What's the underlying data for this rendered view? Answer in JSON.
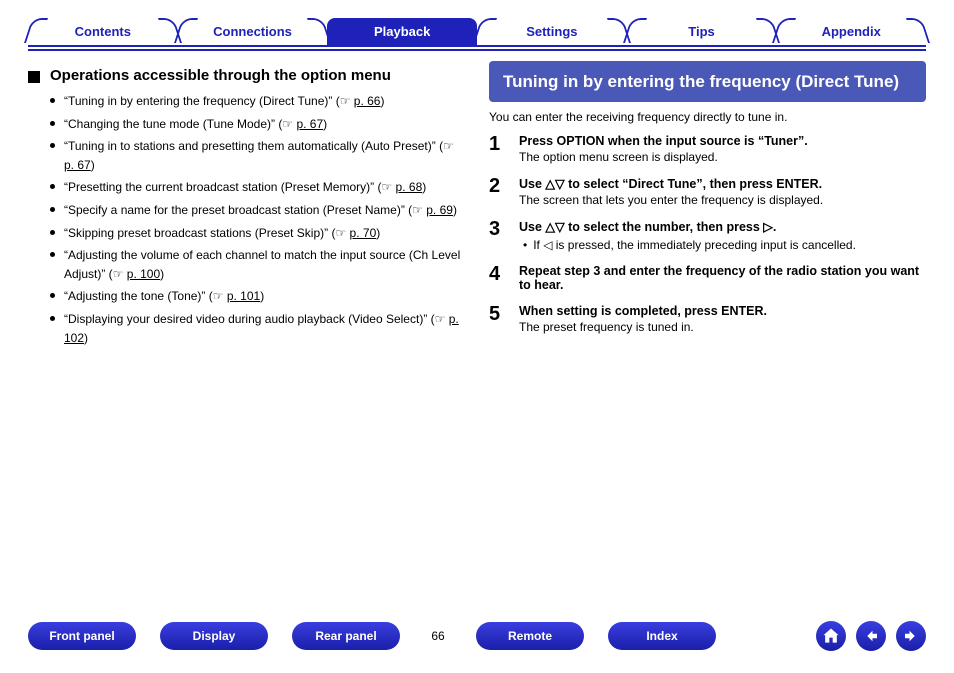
{
  "tabs": [
    "Contents",
    "Connections",
    "Playback",
    "Settings",
    "Tips",
    "Appendix"
  ],
  "active_tab_index": 2,
  "left": {
    "heading": "Operations accessible through the option menu",
    "items": [
      {
        "text": "“Tuning in by entering the frequency (Direct Tune)” (",
        "page": "p. 66",
        "tail": ")"
      },
      {
        "text": "“Changing the tune mode (Tune Mode)” (",
        "page": "p. 67",
        "tail": ")"
      },
      {
        "text": "“Tuning in to stations and presetting them automatically (Auto Preset)” (",
        "page": "p. 67",
        "tail": ")"
      },
      {
        "text": "“Presetting the current broadcast station (Preset Memory)” (",
        "page": "p. 68",
        "tail": ")"
      },
      {
        "text": "“Specify a name for the preset broadcast station (Preset Name)” (",
        "page": "p. 69",
        "tail": ")"
      },
      {
        "text": "“Skipping preset broadcast stations (Preset Skip)” (",
        "page": "p. 70",
        "tail": ")"
      },
      {
        "text": "“Adjusting the volume of each channel to match the input source (Ch Level Adjust)” (",
        "page": "p. 100",
        "tail": ")"
      },
      {
        "text": "“Adjusting the tone (Tone)” (",
        "page": "p. 101",
        "tail": ")"
      },
      {
        "text": "“Displaying your desired video during audio playback (Video Select)” (",
        "page": "p. 102",
        "tail": ")"
      }
    ]
  },
  "right": {
    "title": "Tuning in by entering the frequency (Direct Tune)",
    "intro": "You can enter the receiving frequency directly to tune in.",
    "steps": [
      {
        "num": "1",
        "bold": "Press OPTION when the input source is “Tuner”.",
        "sub": "The option menu screen is displayed."
      },
      {
        "num": "2",
        "bold": "Use △▽ to select “Direct Tune”, then press ENTER.",
        "sub": "The screen that lets you enter the frequency is displayed."
      },
      {
        "num": "3",
        "bold": "Use △▽ to select the number, then press ▷.",
        "sub_bullet": "If ◁ is pressed, the immediately preceding input is cancelled."
      },
      {
        "num": "4",
        "bold": "Repeat step 3 and enter the frequency of the radio station you want to hear."
      },
      {
        "num": "5",
        "bold": "When setting is completed, press ENTER.",
        "sub": "The preset frequency is tuned in."
      }
    ]
  },
  "bottom": {
    "buttons": [
      "Front panel",
      "Display",
      "Rear panel",
      "Remote",
      "Index"
    ],
    "page": "66"
  },
  "glyphs": {
    "hand": "☞ "
  }
}
